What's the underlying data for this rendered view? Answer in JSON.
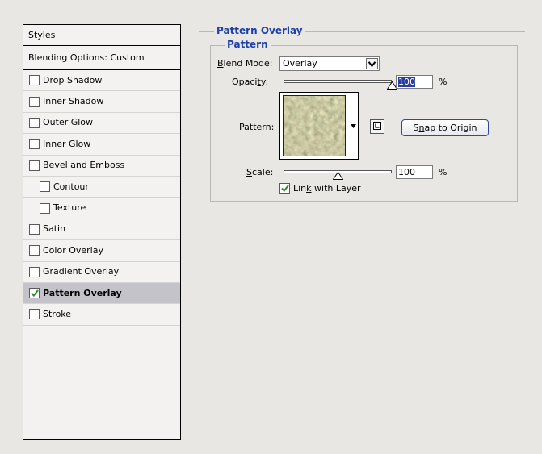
{
  "styles_panel": {
    "header": "Styles",
    "blending_options": "Blending Options: Custom",
    "items": [
      {
        "label": "Drop Shadow",
        "checked": false,
        "sub": false,
        "active": false
      },
      {
        "label": "Inner Shadow",
        "checked": false,
        "sub": false,
        "active": false
      },
      {
        "label": "Outer Glow",
        "checked": false,
        "sub": false,
        "active": false
      },
      {
        "label": "Inner Glow",
        "checked": false,
        "sub": false,
        "active": false
      },
      {
        "label": "Bevel and Emboss",
        "checked": false,
        "sub": false,
        "active": false
      },
      {
        "label": "Contour",
        "checked": false,
        "sub": true,
        "active": false
      },
      {
        "label": "Texture",
        "checked": false,
        "sub": true,
        "active": false
      },
      {
        "label": "Satin",
        "checked": false,
        "sub": false,
        "active": false
      },
      {
        "label": "Color Overlay",
        "checked": false,
        "sub": false,
        "active": false
      },
      {
        "label": "Gradient Overlay",
        "checked": false,
        "sub": false,
        "active": false
      },
      {
        "label": "Pattern Overlay",
        "checked": true,
        "sub": false,
        "active": true
      },
      {
        "label": "Stroke",
        "checked": false,
        "sub": false,
        "active": false
      }
    ]
  },
  "pattern_overlay": {
    "title": "Pattern Overlay",
    "group_title": "Pattern",
    "blend_mode": {
      "label_b": "B",
      "label_rest": "lend Mode:",
      "value": "Overlay"
    },
    "opacity": {
      "label_pre": "Opaci",
      "label_u": "t",
      "label_post": "y:",
      "value": "100",
      "unit": "%",
      "level": 100
    },
    "pattern": {
      "label": "Pattern:"
    },
    "snap_button": {
      "pre": "S",
      "u": "n",
      "post": "ap to Origin"
    },
    "scale": {
      "label_u": "S",
      "label_rest": "cale:",
      "value": "100",
      "unit": "%",
      "level": 100
    },
    "link_with_layer": {
      "pre": "Lin",
      "u": "k",
      "post": " with Layer",
      "checked": true
    }
  },
  "colors": {
    "accent_title": "#1d3fa6",
    "active_row": "#c4c3c9",
    "checkmark": "#2f8a2f"
  }
}
